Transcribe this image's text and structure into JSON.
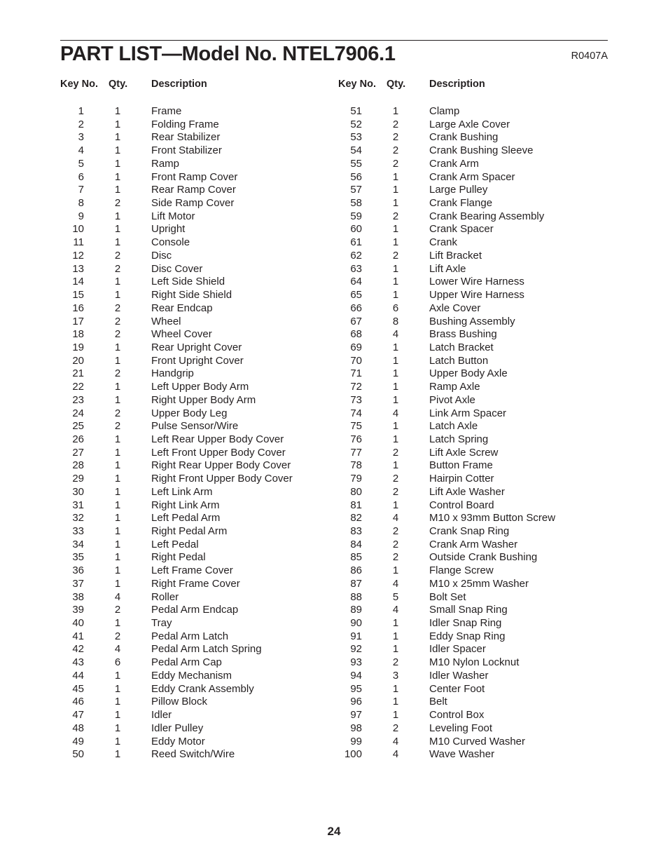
{
  "header": {
    "title": "PART LIST—Model No. NTEL7906.1",
    "code": "R0407A"
  },
  "columns": {
    "key": "Key No.",
    "qty": "Qty.",
    "description": "Description"
  },
  "parts_left": [
    {
      "key": "1",
      "qty": "1",
      "desc": "Frame"
    },
    {
      "key": "2",
      "qty": "1",
      "desc": "Folding Frame"
    },
    {
      "key": "3",
      "qty": "1",
      "desc": "Rear Stabilizer"
    },
    {
      "key": "4",
      "qty": "1",
      "desc": "Front Stabilizer"
    },
    {
      "key": "5",
      "qty": "1",
      "desc": "Ramp"
    },
    {
      "key": "6",
      "qty": "1",
      "desc": "Front Ramp Cover"
    },
    {
      "key": "7",
      "qty": "1",
      "desc": "Rear Ramp Cover"
    },
    {
      "key": "8",
      "qty": "2",
      "desc": "Side Ramp Cover"
    },
    {
      "key": "9",
      "qty": "1",
      "desc": "Lift Motor"
    },
    {
      "key": "10",
      "qty": "1",
      "desc": "Upright"
    },
    {
      "key": "11",
      "qty": "1",
      "desc": "Console"
    },
    {
      "key": "12",
      "qty": "2",
      "desc": "Disc"
    },
    {
      "key": "13",
      "qty": "2",
      "desc": "Disc Cover"
    },
    {
      "key": "14",
      "qty": "1",
      "desc": "Left Side Shield"
    },
    {
      "key": "15",
      "qty": "1",
      "desc": "Right Side Shield"
    },
    {
      "key": "16",
      "qty": "2",
      "desc": "Rear Endcap"
    },
    {
      "key": "17",
      "qty": "2",
      "desc": "Wheel"
    },
    {
      "key": "18",
      "qty": "2",
      "desc": "Wheel Cover"
    },
    {
      "key": "19",
      "qty": "1",
      "desc": "Rear Upright Cover"
    },
    {
      "key": "20",
      "qty": "1",
      "desc": "Front Upright Cover"
    },
    {
      "key": "21",
      "qty": "2",
      "desc": "Handgrip"
    },
    {
      "key": "22",
      "qty": "1",
      "desc": "Left Upper Body Arm"
    },
    {
      "key": "23",
      "qty": "1",
      "desc": "Right Upper Body Arm"
    },
    {
      "key": "24",
      "qty": "2",
      "desc": "Upper Body Leg"
    },
    {
      "key": "25",
      "qty": "2",
      "desc": "Pulse Sensor/Wire"
    },
    {
      "key": "26",
      "qty": "1",
      "desc": "Left Rear Upper Body Cover"
    },
    {
      "key": "27",
      "qty": "1",
      "desc": "Left Front Upper Body Cover"
    },
    {
      "key": "28",
      "qty": "1",
      "desc": "Right Rear Upper Body Cover"
    },
    {
      "key": "29",
      "qty": "1",
      "desc": "Right Front Upper Body Cover"
    },
    {
      "key": "30",
      "qty": "1",
      "desc": "Left Link Arm"
    },
    {
      "key": "31",
      "qty": "1",
      "desc": "Right Link Arm"
    },
    {
      "key": "32",
      "qty": "1",
      "desc": "Left Pedal Arm"
    },
    {
      "key": "33",
      "qty": "1",
      "desc": "Right Pedal Arm"
    },
    {
      "key": "34",
      "qty": "1",
      "desc": "Left Pedal"
    },
    {
      "key": "35",
      "qty": "1",
      "desc": "Right Pedal"
    },
    {
      "key": "36",
      "qty": "1",
      "desc": "Left Frame Cover"
    },
    {
      "key": "37",
      "qty": "1",
      "desc": "Right Frame Cover"
    },
    {
      "key": "38",
      "qty": "4",
      "desc": "Roller"
    },
    {
      "key": "39",
      "qty": "2",
      "desc": "Pedal Arm Endcap"
    },
    {
      "key": "40",
      "qty": "1",
      "desc": "Tray"
    },
    {
      "key": "41",
      "qty": "2",
      "desc": "Pedal Arm Latch"
    },
    {
      "key": "42",
      "qty": "4",
      "desc": "Pedal Arm Latch Spring"
    },
    {
      "key": "43",
      "qty": "6",
      "desc": "Pedal Arm Cap"
    },
    {
      "key": "44",
      "qty": "1",
      "desc": "Eddy Mechanism"
    },
    {
      "key": "45",
      "qty": "1",
      "desc": "Eddy Crank Assembly"
    },
    {
      "key": "46",
      "qty": "1",
      "desc": "Pillow Block"
    },
    {
      "key": "47",
      "qty": "1",
      "desc": "Idler"
    },
    {
      "key": "48",
      "qty": "1",
      "desc": "Idler Pulley"
    },
    {
      "key": "49",
      "qty": "1",
      "desc": "Eddy Motor"
    },
    {
      "key": "50",
      "qty": "1",
      "desc": "Reed Switch/Wire"
    }
  ],
  "parts_right": [
    {
      "key": "51",
      "qty": "1",
      "desc": "Clamp"
    },
    {
      "key": "52",
      "qty": "2",
      "desc": "Large Axle Cover"
    },
    {
      "key": "53",
      "qty": "2",
      "desc": "Crank Bushing"
    },
    {
      "key": "54",
      "qty": "2",
      "desc": "Crank Bushing Sleeve"
    },
    {
      "key": "55",
      "qty": "2",
      "desc": "Crank Arm"
    },
    {
      "key": "56",
      "qty": "1",
      "desc": "Crank Arm Spacer"
    },
    {
      "key": "57",
      "qty": "1",
      "desc": "Large Pulley"
    },
    {
      "key": "58",
      "qty": "1",
      "desc": "Crank Flange"
    },
    {
      "key": "59",
      "qty": "2",
      "desc": "Crank Bearing Assembly"
    },
    {
      "key": "60",
      "qty": "1",
      "desc": "Crank Spacer"
    },
    {
      "key": "61",
      "qty": "1",
      "desc": "Crank"
    },
    {
      "key": "62",
      "qty": "2",
      "desc": "Lift Bracket"
    },
    {
      "key": "63",
      "qty": "1",
      "desc": "Lift Axle"
    },
    {
      "key": "64",
      "qty": "1",
      "desc": "Lower Wire Harness"
    },
    {
      "key": "65",
      "qty": "1",
      "desc": "Upper Wire Harness"
    },
    {
      "key": "66",
      "qty": "6",
      "desc": "Axle Cover"
    },
    {
      "key": "67",
      "qty": "8",
      "desc": "Bushing Assembly"
    },
    {
      "key": "68",
      "qty": "4",
      "desc": "Brass Bushing"
    },
    {
      "key": "69",
      "qty": "1",
      "desc": "Latch Bracket"
    },
    {
      "key": "70",
      "qty": "1",
      "desc": "Latch Button"
    },
    {
      "key": "71",
      "qty": "1",
      "desc": "Upper Body Axle"
    },
    {
      "key": "72",
      "qty": "1",
      "desc": "Ramp Axle"
    },
    {
      "key": "73",
      "qty": "1",
      "desc": "Pivot Axle"
    },
    {
      "key": "74",
      "qty": "4",
      "desc": "Link Arm Spacer"
    },
    {
      "key": "75",
      "qty": "1",
      "desc": "Latch Axle"
    },
    {
      "key": "76",
      "qty": "1",
      "desc": "Latch Spring"
    },
    {
      "key": "77",
      "qty": "2",
      "desc": "Lift Axle Screw"
    },
    {
      "key": "78",
      "qty": "1",
      "desc": "Button Frame"
    },
    {
      "key": "79",
      "qty": "2",
      "desc": "Hairpin Cotter"
    },
    {
      "key": "80",
      "qty": "2",
      "desc": "Lift Axle Washer"
    },
    {
      "key": "81",
      "qty": "1",
      "desc": "Control Board"
    },
    {
      "key": "82",
      "qty": "4",
      "desc": "M10 x 93mm Button Screw"
    },
    {
      "key": "83",
      "qty": "2",
      "desc": "Crank Snap Ring"
    },
    {
      "key": "84",
      "qty": "2",
      "desc": "Crank Arm Washer"
    },
    {
      "key": "85",
      "qty": "2",
      "desc": "Outside Crank Bushing"
    },
    {
      "key": "86",
      "qty": "1",
      "desc": "Flange Screw"
    },
    {
      "key": "87",
      "qty": "4",
      "desc": "M10 x 25mm Washer"
    },
    {
      "key": "88",
      "qty": "5",
      "desc": "Bolt Set"
    },
    {
      "key": "89",
      "qty": "4",
      "desc": "Small Snap Ring"
    },
    {
      "key": "90",
      "qty": "1",
      "desc": "Idler Snap Ring"
    },
    {
      "key": "91",
      "qty": "1",
      "desc": "Eddy Snap Ring"
    },
    {
      "key": "92",
      "qty": "1",
      "desc": "Idler Spacer"
    },
    {
      "key": "93",
      "qty": "2",
      "desc": "M10 Nylon Locknut"
    },
    {
      "key": "94",
      "qty": "3",
      "desc": "Idler Washer"
    },
    {
      "key": "95",
      "qty": "1",
      "desc": "Center Foot"
    },
    {
      "key": "96",
      "qty": "1",
      "desc": "Belt"
    },
    {
      "key": "97",
      "qty": "1",
      "desc": "Control Box"
    },
    {
      "key": "98",
      "qty": "2",
      "desc": "Leveling Foot"
    },
    {
      "key": "99",
      "qty": "4",
      "desc": "M10 Curved Washer"
    },
    {
      "key": "100",
      "qty": "4",
      "desc": "Wave Washer"
    }
  ],
  "footer": {
    "page_number": "24"
  }
}
